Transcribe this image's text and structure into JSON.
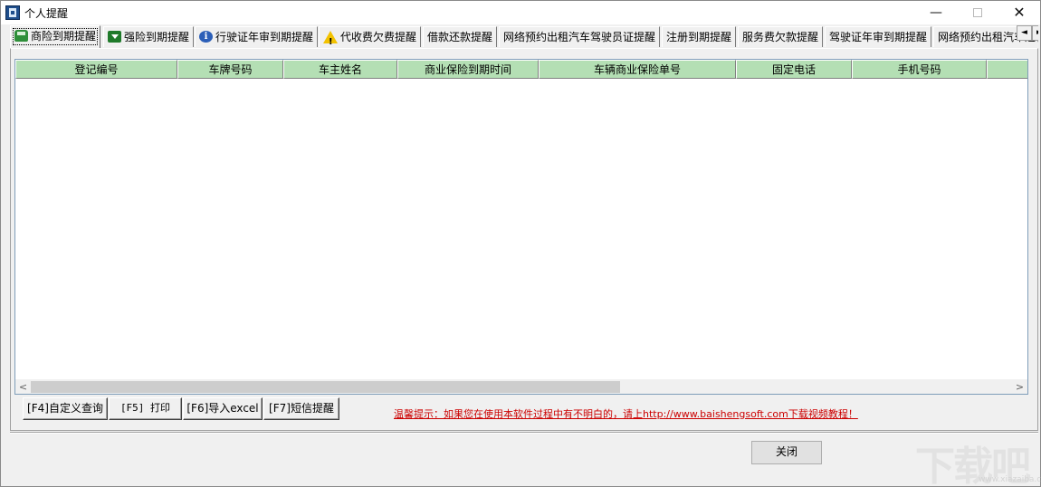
{
  "window": {
    "title": "个人提醒",
    "minimize_glyph": "—",
    "close_glyph": "✕"
  },
  "tabs": [
    {
      "label": "商险到期提醒",
      "icon": "car-green-icon",
      "active": true
    },
    {
      "label": "强险到期提醒",
      "icon": "car-down-icon",
      "active": false
    },
    {
      "label": "行驶证年审到期提醒",
      "icon": "info-icon",
      "active": false
    },
    {
      "label": "代收费欠费提醒",
      "icon": "warning-icon",
      "active": false
    },
    {
      "label": "借款还款提醒",
      "active": false
    },
    {
      "label": "网络预约出租汽车驾驶员证提醒",
      "active": false
    },
    {
      "label": "注册到期提醒",
      "active": false
    },
    {
      "label": "服务费欠款提醒",
      "active": false
    },
    {
      "label": "驾驶证年审到期提醒",
      "active": false
    },
    {
      "label": "网络预约出租汽车运输证提醒",
      "active": false
    }
  ],
  "tab_scroll": {
    "left": "◄",
    "right": "►"
  },
  "grid": {
    "columns": [
      "登记编号",
      "车牌号码",
      "车主姓名",
      "商业保险到期时间",
      "车辆商业保险单号",
      "固定电话",
      "手机号码",
      ""
    ],
    "rows": [],
    "header_color": "#b4dfb4",
    "hscroll_left": "<",
    "hscroll_right": ">"
  },
  "buttons": {
    "custom_query": "[F4]自定义查询",
    "print": "[F5] 打印",
    "import_excel": "[F6]导入excel",
    "sms_reminder": "[F7]短信提醒",
    "close": "关闭"
  },
  "hint_text": "温馨提示：如果您在使用本软件过程中有不明白的，请上http://www.baishengsoft.com下载视频教程！",
  "hint_color": "#cc0000",
  "watermark": {
    "text": "下载吧",
    "url": "www.xiazaiba.com"
  }
}
